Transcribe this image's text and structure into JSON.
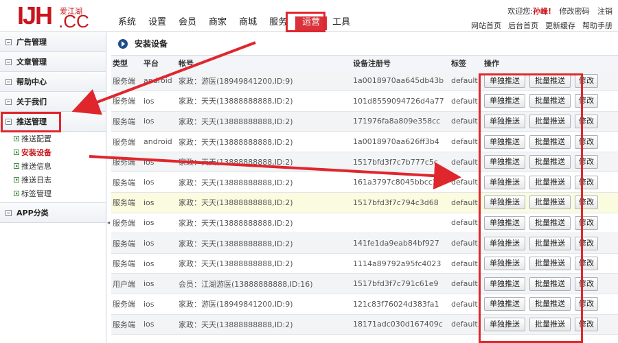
{
  "brand": {
    "logo_main": "IJH",
    "logo_sub": "爱江湖",
    "logo_domain": ".CC"
  },
  "nav": [
    {
      "label": "系统",
      "active": false
    },
    {
      "label": "设置",
      "active": false
    },
    {
      "label": "会员",
      "active": false
    },
    {
      "label": "商家",
      "active": false
    },
    {
      "label": "商城",
      "active": false
    },
    {
      "label": "服务",
      "active": false
    },
    {
      "label": "运营",
      "active": true
    },
    {
      "label": "工具",
      "active": false
    }
  ],
  "user_bar": {
    "welcome_prefix": "欢迎您:",
    "username": "孙峰!",
    "change_password": "修改密码",
    "logout": "注销"
  },
  "top_links": [
    "网站首页",
    "后台首页",
    "更新缓存",
    "帮助手册"
  ],
  "sidebar": {
    "groups_before": [
      "广告管理",
      "文章管理",
      "帮助中心",
      "关于我们"
    ],
    "open_group": "推送管理",
    "sub_items": [
      {
        "label": "推送配置",
        "active": false
      },
      {
        "label": "安装设备",
        "active": true
      },
      {
        "label": "推送信息",
        "active": false
      },
      {
        "label": "推送日志",
        "active": false
      },
      {
        "label": "标签管理",
        "active": false
      }
    ],
    "groups_after": [
      "APP分类"
    ]
  },
  "main": {
    "title": "安装设备",
    "columns": [
      "类型",
      "平台",
      "帐号",
      "设备注册号",
      "标签",
      "操作"
    ],
    "actions": {
      "single_push": "单独推送",
      "batch_push": "批量推送",
      "edit": "修改"
    },
    "rows": [
      {
        "type": "服务端",
        "platform": "android",
        "account": "家政：游医(18949841200,ID:9)",
        "device": "1a0018970aa645db43b",
        "tag": "default"
      },
      {
        "type": "服务端",
        "platform": "ios",
        "account": "家政：天天(13888888888,ID:2)",
        "device": "101d8559094726d4a77",
        "tag": "default"
      },
      {
        "type": "服务端",
        "platform": "ios",
        "account": "家政：天天(13888888888,ID:2)",
        "device": "171976fa8a809e358cc",
        "tag": "default"
      },
      {
        "type": "服务端",
        "platform": "android",
        "account": "家政：天天(13888888888,ID:2)",
        "device": "1a0018970aa626ff3b4",
        "tag": "default"
      },
      {
        "type": "服务端",
        "platform": "ios",
        "account": "家政：天天(13888888888,ID:2)",
        "device": "1517bfd3f7c7b777c5c",
        "tag": "default"
      },
      {
        "type": "服务端",
        "platform": "ios",
        "account": "家政：天天(13888888888,ID:2)",
        "device": "161a3797c8045bbcc24",
        "tag": "default"
      },
      {
        "type": "服务端",
        "platform": "ios",
        "account": "家政：天天(13888888888,ID:2)",
        "device": "1517bfd3f7c794c3d68",
        "tag": "default"
      },
      {
        "type": "服务端",
        "platform": "ios",
        "account": "家政：天天(13888888888,ID:2)",
        "device": "",
        "tag": "default"
      },
      {
        "type": "服务端",
        "platform": "ios",
        "account": "家政：天天(13888888888,ID:2)",
        "device": "141fe1da9eab84bf927",
        "tag": "default"
      },
      {
        "type": "服务端",
        "platform": "ios",
        "account": "家政：天天(13888888888,ID:2)",
        "device": "1114a89792a95fc4023",
        "tag": "default"
      },
      {
        "type": "用户端",
        "platform": "ios",
        "account": "会员：江湖游医(13888888888,ID:16)",
        "device": "1517bfd3f7c791c61e9",
        "tag": "default"
      },
      {
        "type": "服务端",
        "platform": "ios",
        "account": "家政：游医(18949841200,ID:9)",
        "device": "121c83f76024d383fa1",
        "tag": "default"
      },
      {
        "type": "服务端",
        "platform": "ios",
        "account": "家政：天天(13888888888,ID:2)",
        "device": "18171adc030d167409c",
        "tag": "default"
      }
    ]
  },
  "colors": {
    "accent_red": "#e0262d",
    "brand_red": "#c8161d",
    "nav_active": "#d9323a",
    "title_icon": "#1f4f8a"
  }
}
